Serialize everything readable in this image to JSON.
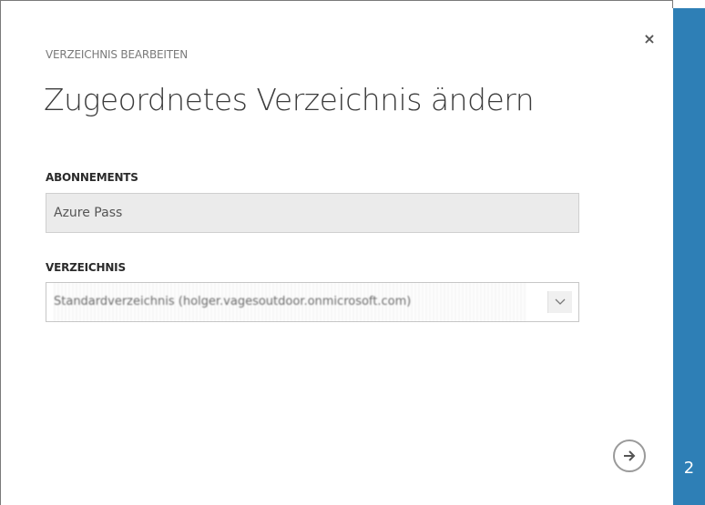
{
  "dialog": {
    "subtitle": "VERZEICHNIS BEARBEITEN",
    "title": "Zugeordnetes Verzeichnis ändern",
    "close_label": "×"
  },
  "subscriptions": {
    "label": "ABONNEMENTS",
    "value": "Azure Pass"
  },
  "directory": {
    "label": "VERZEICHNIS",
    "selected": "Standardverzeichnis (holger.vagesoutdoor.onmicrosoft.com)"
  },
  "wizard": {
    "step": "2",
    "next_icon": "arrow-right-icon"
  },
  "colors": {
    "accent": "#2e7fb6",
    "field_bg": "#ebebeb"
  }
}
